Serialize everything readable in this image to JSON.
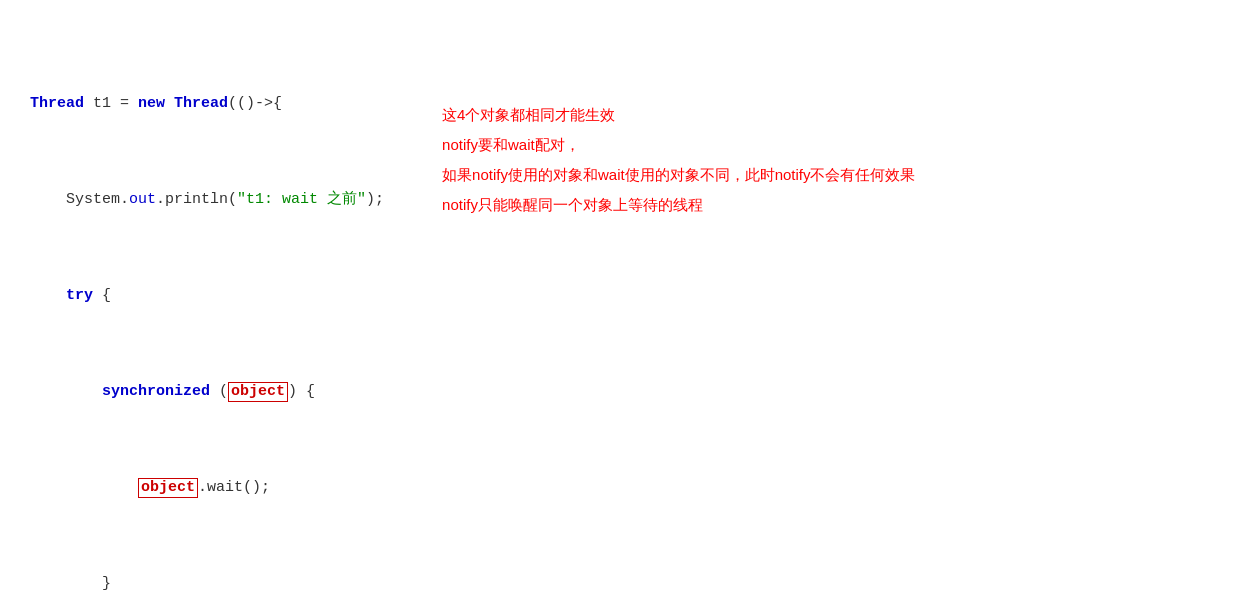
{
  "code": {
    "lines": [
      "Thread t1 = new Thread(()->{"
    ]
  },
  "annotations": {
    "line1": "这4个对象都相同才能生效",
    "line2": "notify要和wait配对，",
    "line3": "如果notify使用的对象和wait使用的对象不同，此时notify不会有任何效果",
    "line4": "notify只能唤醒同一个对象上等待的线程"
  }
}
